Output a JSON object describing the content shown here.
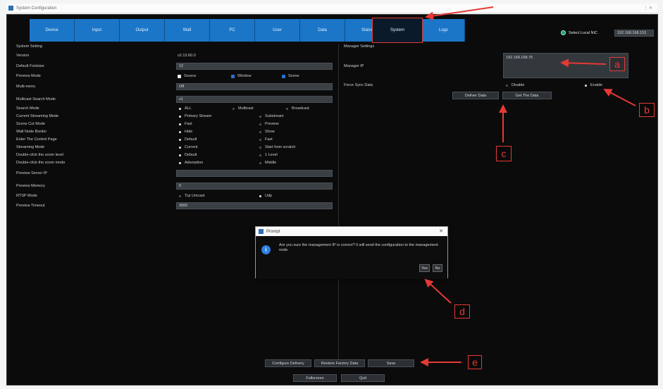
{
  "window": {
    "title": "System Configuration"
  },
  "tabs": [
    {
      "label": "Device"
    },
    {
      "label": "Input"
    },
    {
      "label": "Output"
    },
    {
      "label": "Wall"
    },
    {
      "label": "PC"
    },
    {
      "label": "User"
    },
    {
      "label": "Data"
    },
    {
      "label": "Status"
    },
    {
      "label": "System",
      "active": true
    },
    {
      "label": "Logs"
    }
  ],
  "nic": {
    "label": "Select Local NIC",
    "value": "192.168.168.153"
  },
  "left": {
    "section": "System Setting",
    "version": {
      "label": "Version",
      "value": "v2.13.60.0"
    },
    "default_fontsize": {
      "label": "Default Fontsize",
      "value": "12"
    },
    "preview_mode": {
      "label": "Preview Mode",
      "options": [
        "Source",
        "Window",
        "Scene"
      ]
    },
    "multi_menu": {
      "label": "Multi-menu",
      "value": "Off"
    },
    "multicast_search": {
      "label": "Multicast Search Mode",
      "value": "v1"
    },
    "search_mode": {
      "label": "Search Mode",
      "options": [
        "ALL",
        "Multicast",
        "Broadcast"
      ]
    },
    "radio_rows": [
      {
        "label": "Current Streaming Mode",
        "a": "Primary Stream",
        "b": "Substream"
      },
      {
        "label": "Scene Cut Mode",
        "a": "Fast",
        "b": "Preview"
      },
      {
        "label": "Wall Node Border",
        "a": "Hide",
        "b": "Show"
      },
      {
        "label": "Enter The Control Page",
        "a": "Default",
        "b": "Fast"
      },
      {
        "label": "Streaming Mode",
        "a": "Current",
        "b": "Start from scratch"
      },
      {
        "label": "Double-click the zoom level",
        "a": "Default",
        "b": "1 Level"
      },
      {
        "label": "Double-click the zoom mode",
        "a": "Adsorption",
        "b": "Middle"
      }
    ],
    "preview_server_ip": {
      "label": "Preview Server IP",
      "value": ""
    },
    "preview_memory": {
      "label": "Preview Memory",
      "value": "0"
    },
    "rtsp_mode": {
      "label": "RTSP Mode",
      "a": "Tcp Unicast",
      "b": "Udp"
    },
    "preview_timeout": {
      "label": "Preview Timeout",
      "value": "3000"
    }
  },
  "right": {
    "section": "Manager Settings",
    "manager_ip": {
      "label": "Manager IP",
      "value": "192.168.168.75"
    },
    "force_sync": {
      "label": "Force Sync Data",
      "a": "Disable",
      "b": "Enable"
    },
    "deliver_btn": "Deliver Data",
    "get_btn": "Get The Data"
  },
  "bottom": {
    "configure_delivery": "Configure Delivery",
    "restore_factory": "Restore Factory Data",
    "save": "Save",
    "fullscreen": "Fullscreen",
    "quit": "Quit"
  },
  "dialog": {
    "title": "Prompt",
    "close": "✕",
    "icon": "i",
    "message": "Are you sure the management IP is correct? It will send the configuration to the management node.",
    "yes": "Yes",
    "no": "No"
  },
  "annotations": {
    "a": "a",
    "b": "b",
    "c": "c",
    "d": "d",
    "e": "e"
  },
  "colors": {
    "accent": "#1b76c8",
    "highlight": "#e53935",
    "background": "#0b0b0b"
  }
}
